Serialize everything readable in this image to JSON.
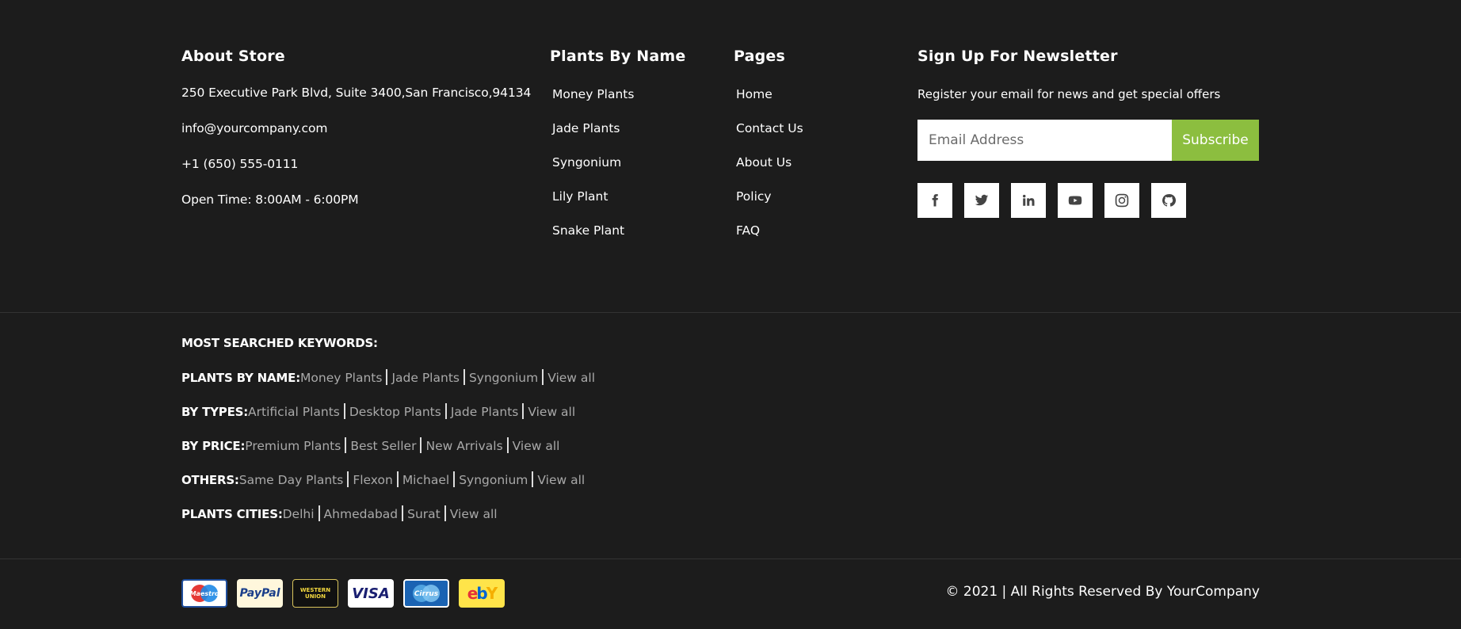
{
  "about": {
    "title": "About Store",
    "address": "250 Executive Park Blvd, Suite 3400,San Francisco,94134",
    "email": "info@yourcompany.com",
    "phone": "+1 (650) 555-0111",
    "hours": "Open Time: 8:00AM - 6:00PM"
  },
  "plants_by_name": {
    "title": "Plants By Name",
    "items": [
      "Money Plants",
      "Jade Plants",
      "Syngonium",
      "Lily Plant",
      "Snake Plant"
    ]
  },
  "pages": {
    "title": "Pages",
    "items": [
      "Home",
      "Contact Us",
      "About Us",
      "Policy",
      "FAQ"
    ]
  },
  "newsletter": {
    "title": "Sign Up For Newsletter",
    "description": "Register your email for news and get special offers",
    "placeholder": "Email Address",
    "button_label": "Subscribe",
    "socials": [
      "facebook-icon",
      "twitter-icon",
      "linkedin-icon",
      "youtube-icon",
      "instagram-icon",
      "github-icon"
    ]
  },
  "keywords": {
    "heading": "MOST SEARCHED KEYWORDS:",
    "rows": [
      {
        "label": "PLANTS BY NAME:",
        "items": [
          "Money Plants",
          "Jade Plants",
          "Syngonium",
          "View all"
        ]
      },
      {
        "label": "BY TYPES:",
        "items": [
          "Artificial Plants",
          "Desktop Plants",
          "Jade Plants",
          "View all"
        ]
      },
      {
        "label": "BY PRICE:",
        "items": [
          "Premium Plants",
          "Best Seller",
          "New Arrivals",
          "View all"
        ]
      },
      {
        "label": "OTHERS:",
        "items": [
          "Same Day Plants",
          "Flexon",
          "Michael",
          "Syngonium",
          "View all"
        ]
      },
      {
        "label": "PLANTS CITIES:",
        "items": [
          "Delhi",
          "Ahmedabad",
          "Surat",
          "View all"
        ]
      }
    ]
  },
  "payments": [
    {
      "name": "maestro",
      "text": "Maestro"
    },
    {
      "name": "paypal",
      "text": "PayPal"
    },
    {
      "name": "western-union",
      "text": "WESTERN UNION"
    },
    {
      "name": "visa",
      "text": "VISA"
    },
    {
      "name": "cirrus",
      "text": "Cirrus"
    },
    {
      "name": "ebay",
      "text": "ebY"
    }
  ],
  "copyright": "© 2021 | All Rights Reserved By YourCompany",
  "colors": {
    "background": "#1c1c1c",
    "accent": "#8cbe3f",
    "muted_link": "#a9a9a9"
  }
}
